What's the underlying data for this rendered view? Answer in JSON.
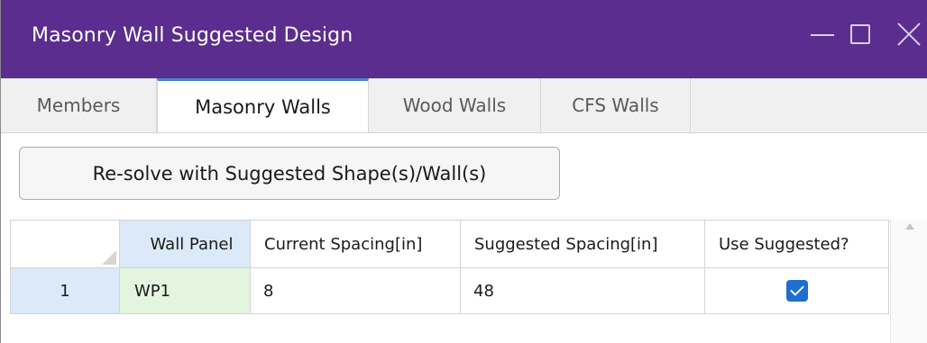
{
  "window": {
    "title": "Masonry Wall Suggested Design",
    "colors": {
      "titlebar": "#5a2d8e",
      "active_tab_accent": "#4a86d0",
      "checkbox": "#1e6fd0"
    }
  },
  "tabs": [
    {
      "label": "Members",
      "active": false
    },
    {
      "label": "Masonry Walls",
      "active": true
    },
    {
      "label": "Wood Walls",
      "active": false
    },
    {
      "label": "CFS Walls",
      "active": false
    }
  ],
  "actions": {
    "resolve_label": "Re-solve with Suggested Shape(s)/Wall(s)"
  },
  "table": {
    "columns": [
      "Wall Panel",
      "Current Spacing[in]",
      "Suggested Spacing[in]",
      "Use Suggested?"
    ],
    "rows": [
      {
        "index": "1",
        "wall_panel": "WP1",
        "current_spacing": "8",
        "suggested_spacing": "48",
        "use_suggested": true
      }
    ]
  }
}
